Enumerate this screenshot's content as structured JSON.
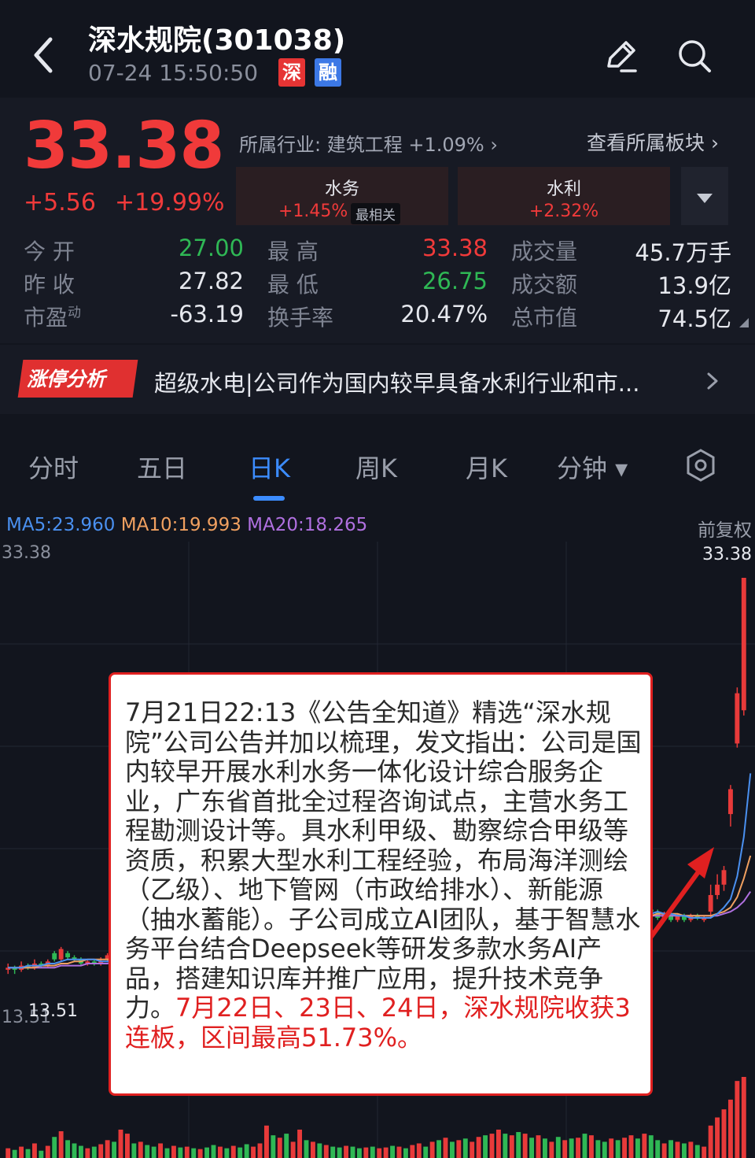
{
  "header": {
    "title": "深水规院(301038)",
    "datetime": "07-24 15:50:50",
    "tag_exchange": "深",
    "tag_margin": "融"
  },
  "quote": {
    "price": "33.38",
    "change": "+5.56",
    "change_pct": "+19.99%",
    "industry": "所属行业:  建筑工程 +1.09% ›",
    "sector_link": "查看所属板块 ›",
    "concepts": [
      {
        "name": "水务",
        "change": "+1.45%",
        "badge": "最相关"
      },
      {
        "name": "水利",
        "change": "+2.32%"
      }
    ]
  },
  "stats": {
    "open_label": "今    开",
    "open": "27.00",
    "high_label": "最    高",
    "high": "33.38",
    "volume_label": "成交量",
    "volume": "45.7万手",
    "prev_close_label": "昨    收",
    "prev_close": "27.82",
    "low_label": "最    低",
    "low": "26.75",
    "amount_label": "成交额",
    "amount": "13.9亿",
    "pe_label": "市盈",
    "pe_sup": "动",
    "pe": "-63.19",
    "turnover_label": "换手率",
    "turnover": "20.47%",
    "mktcap_label": "总市值",
    "mktcap": "74.5亿"
  },
  "limit_analysis": {
    "badge": "涨停分析",
    "text": "超级水电|公司作为国内较早具备水利行业和市..."
  },
  "tabs": [
    "分时",
    "五日",
    "日K",
    "周K",
    "月K",
    "分钟 ▾"
  ],
  "active_tab": "日K",
  "chart": {
    "ma5": "MA5:23.960",
    "ma10": "MA10:19.993",
    "ma20": "MA20:18.265",
    "adjust": "前复权",
    "top_left": "33.38",
    "top_right": "33.38",
    "bottom_left": "13.51",
    "low_marker": "13.51",
    "colors": {
      "up": "#e83a3a",
      "down": "#2fb855",
      "ma5": "#4a90f0",
      "ma10": "#f0a060",
      "ma20": "#b070e0"
    }
  },
  "chart_data": {
    "type": "candlestick",
    "ylim": [
      13.51,
      33.38
    ],
    "candles": [
      {
        "o": 14.5,
        "c": 14.6,
        "h": 14.8,
        "l": 14.3
      },
      {
        "o": 14.6,
        "c": 14.5,
        "h": 14.7,
        "l": 14.3
      },
      {
        "o": 14.5,
        "c": 14.7,
        "h": 14.9,
        "l": 14.4
      },
      {
        "o": 14.7,
        "c": 14.6,
        "h": 14.8,
        "l": 14.5
      },
      {
        "o": 14.6,
        "c": 14.8,
        "h": 15.0,
        "l": 14.5
      },
      {
        "o": 14.8,
        "c": 14.7,
        "h": 14.9,
        "l": 14.6
      },
      {
        "o": 14.7,
        "c": 14.9,
        "h": 15.0,
        "l": 14.6
      },
      {
        "o": 15.3,
        "c": 15.0,
        "h": 15.4,
        "l": 14.9
      },
      {
        "o": 15.0,
        "c": 15.5,
        "h": 15.6,
        "l": 14.9
      },
      {
        "o": 15.3,
        "c": 15.1,
        "h": 15.4,
        "l": 15.0
      },
      {
        "o": 15.1,
        "c": 15.0,
        "h": 15.2,
        "l": 14.9
      },
      {
        "o": 15.0,
        "c": 14.8,
        "h": 15.1,
        "l": 14.7
      },
      {
        "o": 14.8,
        "c": 14.9,
        "h": 15.0,
        "l": 14.7
      },
      {
        "o": 14.9,
        "c": 14.8,
        "h": 15.0,
        "l": 14.7
      },
      {
        "o": 14.8,
        "c": 14.9,
        "h": 15.1,
        "l": 14.7
      },
      {
        "o": 15.0,
        "c": 15.2,
        "h": 15.3,
        "l": 14.9
      },
      {
        "o": 15.2,
        "c": 15.1,
        "h": 15.3,
        "l": 15.0
      },
      {
        "o": 15.2,
        "c": 15.7,
        "h": 15.8,
        "l": 15.1
      },
      {
        "o": 15.7,
        "c": 15.9,
        "h": 16.0,
        "l": 15.6
      },
      {
        "o": 15.9,
        "c": 15.8,
        "h": 16.0,
        "l": 15.7
      },
      {
        "o": 15.8,
        "c": 16.0,
        "h": 16.1,
        "l": 15.7
      },
      {
        "o": 16.0,
        "c": 15.8,
        "h": 16.1,
        "l": 15.6
      },
      {
        "o": 15.8,
        "c": 15.6,
        "h": 15.9,
        "l": 15.5
      },
      {
        "o": 15.6,
        "c": 15.8,
        "h": 15.9,
        "l": 15.5
      },
      {
        "o": 15.8,
        "c": 15.7,
        "h": 15.9,
        "l": 15.6
      },
      {
        "o": 15.6,
        "c": 15.7,
        "h": 15.8,
        "l": 15.5
      },
      {
        "o": 15.7,
        "c": 15.6,
        "h": 15.8,
        "l": 15.5
      },
      {
        "o": 15.6,
        "c": 15.7,
        "h": 15.8,
        "l": 15.5
      },
      {
        "o": 15.5,
        "c": 15.4,
        "h": 15.7,
        "l": 15.3
      },
      {
        "o": 15.5,
        "c": 15.6,
        "h": 15.7,
        "l": 15.4
      },
      {
        "o": 15.6,
        "c": 15.4,
        "h": 15.7,
        "l": 15.3
      },
      {
        "o": 15.4,
        "c": 15.3,
        "h": 15.5,
        "l": 15.2
      },
      {
        "o": 15.3,
        "c": 15.4,
        "h": 15.5,
        "l": 15.2
      },
      {
        "o": 15.4,
        "c": 15.3,
        "h": 15.5,
        "l": 15.2
      },
      {
        "o": 15.3,
        "c": 15.5,
        "h": 15.6,
        "l": 15.2
      },
      {
        "o": 15.5,
        "c": 15.4,
        "h": 15.6,
        "l": 15.3
      },
      {
        "o": 15.6,
        "c": 15.4,
        "h": 15.7,
        "l": 15.3
      },
      {
        "o": 15.4,
        "c": 15.5,
        "h": 15.6,
        "l": 15.3
      },
      {
        "o": 15.5,
        "c": 15.7,
        "h": 15.8,
        "l": 15.4
      },
      {
        "o": 15.7,
        "c": 16.2,
        "h": 16.4,
        "l": 15.6
      },
      {
        "o": 16.2,
        "c": 16.1,
        "h": 16.3,
        "l": 15.9
      },
      {
        "o": 16.1,
        "c": 16.3,
        "h": 16.4,
        "l": 16.0
      },
      {
        "o": 16.3,
        "c": 16.0,
        "h": 16.4,
        "l": 15.9
      },
      {
        "o": 16.0,
        "c": 16.2,
        "h": 16.3,
        "l": 15.9
      },
      {
        "o": 16.2,
        "c": 16.5,
        "h": 16.6,
        "l": 16.1
      },
      {
        "o": 16.5,
        "c": 16.3,
        "h": 16.6,
        "l": 16.2
      },
      {
        "o": 16.3,
        "c": 16.4,
        "h": 16.5,
        "l": 16.2
      },
      {
        "o": 16.4,
        "c": 16.3,
        "h": 16.5,
        "l": 16.2
      },
      {
        "o": 16.3,
        "c": 16.4,
        "h": 16.5,
        "l": 16.2
      },
      {
        "o": 16.4,
        "c": 16.3,
        "h": 16.5,
        "l": 16.2
      },
      {
        "o": 16.3,
        "c": 16.2,
        "h": 16.4,
        "l": 16.1
      },
      {
        "o": 16.2,
        "c": 16.3,
        "h": 16.4,
        "l": 16.1
      },
      {
        "o": 16.3,
        "c": 16.2,
        "h": 16.4,
        "l": 16.1
      },
      {
        "o": 16.2,
        "c": 16.1,
        "h": 16.3,
        "l": 16.0
      },
      {
        "o": 16.1,
        "c": 16.2,
        "h": 16.3,
        "l": 16.0
      },
      {
        "o": 16.2,
        "c": 16.1,
        "h": 16.3,
        "l": 16.0
      },
      {
        "o": 16.1,
        "c": 16.2,
        "h": 16.3,
        "l": 16.0
      },
      {
        "o": 16.2,
        "c": 16.3,
        "h": 16.4,
        "l": 16.1
      },
      {
        "o": 16.3,
        "c": 16.2,
        "h": 16.4,
        "l": 16.1
      },
      {
        "o": 16.2,
        "c": 16.3,
        "h": 16.4,
        "l": 16.1
      },
      {
        "o": 16.3,
        "c": 16.2,
        "h": 16.4,
        "l": 16.1
      },
      {
        "o": 16.2,
        "c": 16.4,
        "h": 16.5,
        "l": 16.1
      },
      {
        "o": 16.4,
        "c": 16.5,
        "h": 16.6,
        "l": 16.3
      },
      {
        "o": 16.5,
        "c": 16.4,
        "h": 16.6,
        "l": 16.3
      },
      {
        "o": 16.4,
        "c": 16.6,
        "h": 16.8,
        "l": 16.3
      },
      {
        "o": 16.6,
        "c": 16.5,
        "h": 16.7,
        "l": 16.4
      },
      {
        "o": 16.5,
        "c": 16.7,
        "h": 16.8,
        "l": 16.4
      },
      {
        "o": 16.7,
        "c": 16.6,
        "h": 16.8,
        "l": 16.5
      },
      {
        "o": 16.6,
        "c": 16.8,
        "h": 16.9,
        "l": 16.5
      },
      {
        "o": 16.8,
        "c": 16.7,
        "h": 16.9,
        "l": 16.6
      },
      {
        "o": 16.7,
        "c": 16.8,
        "h": 16.9,
        "l": 16.6
      },
      {
        "o": 16.8,
        "c": 16.9,
        "h": 17.0,
        "l": 16.7
      },
      {
        "o": 16.9,
        "c": 16.8,
        "h": 17.0,
        "l": 16.7
      },
      {
        "o": 16.8,
        "c": 16.9,
        "h": 17.0,
        "l": 16.7
      },
      {
        "o": 16.9,
        "c": 17.0,
        "h": 17.1,
        "l": 16.8
      },
      {
        "o": 17.0,
        "c": 16.9,
        "h": 17.1,
        "l": 16.8
      },
      {
        "o": 16.9,
        "c": 17.1,
        "h": 17.2,
        "l": 16.8
      },
      {
        "o": 17.1,
        "c": 17.0,
        "h": 17.2,
        "l": 16.9
      },
      {
        "o": 17.0,
        "c": 17.2,
        "h": 17.3,
        "l": 16.9
      },
      {
        "o": 17.2,
        "c": 17.1,
        "h": 17.3,
        "l": 17.0
      },
      {
        "o": 17.1,
        "c": 17.2,
        "h": 17.3,
        "l": 17.0
      },
      {
        "o": 17.0,
        "c": 16.8,
        "h": 17.1,
        "l": 16.7
      },
      {
        "o": 16.8,
        "c": 17.0,
        "h": 17.1,
        "l": 16.7
      },
      {
        "o": 17.0,
        "c": 16.9,
        "h": 17.1,
        "l": 16.8
      },
      {
        "o": 16.9,
        "c": 17.1,
        "h": 17.2,
        "l": 16.8
      },
      {
        "o": 17.1,
        "c": 17.0,
        "h": 17.2,
        "l": 16.9
      },
      {
        "o": 17.0,
        "c": 17.2,
        "h": 17.3,
        "l": 16.9
      },
      {
        "o": 17.2,
        "c": 17.1,
        "h": 17.3,
        "l": 17.0
      },
      {
        "o": 17.1,
        "c": 17.3,
        "h": 17.4,
        "l": 17.0
      },
      {
        "o": 17.3,
        "c": 17.2,
        "h": 17.4,
        "l": 17.1
      },
      {
        "o": 17.2,
        "c": 17.0,
        "h": 17.3,
        "l": 16.9
      },
      {
        "o": 17.0,
        "c": 17.1,
        "h": 17.2,
        "l": 16.9
      },
      {
        "o": 17.1,
        "c": 17.0,
        "h": 17.2,
        "l": 16.9
      },
      {
        "o": 17.0,
        "c": 17.2,
        "h": 17.3,
        "l": 16.9
      },
      {
        "o": 17.2,
        "c": 17.3,
        "h": 17.4,
        "l": 17.1
      },
      {
        "o": 17.3,
        "c": 17.2,
        "h": 17.4,
        "l": 17.1
      },
      {
        "o": 17.2,
        "c": 17.4,
        "h": 17.5,
        "l": 17.1
      },
      {
        "o": 17.4,
        "c": 17.3,
        "h": 17.5,
        "l": 17.2
      },
      {
        "o": 17.3,
        "c": 17.0,
        "h": 17.4,
        "l": 16.9
      },
      {
        "o": 17.0,
        "c": 17.2,
        "h": 17.3,
        "l": 16.9
      },
      {
        "o": 17.2,
        "c": 16.9,
        "h": 17.3,
        "l": 16.8
      },
      {
        "o": 16.9,
        "c": 17.1,
        "h": 17.2,
        "l": 16.8
      },
      {
        "o": 17.1,
        "c": 16.9,
        "h": 17.2,
        "l": 16.8
      },
      {
        "o": 16.9,
        "c": 17.1,
        "h": 17.2,
        "l": 16.8
      },
      {
        "o": 17.1,
        "c": 17.0,
        "h": 17.2,
        "l": 16.9
      },
      {
        "o": 16.9,
        "c": 17.0,
        "h": 17.1,
        "l": 16.8
      },
      {
        "o": 17.3,
        "c": 18.1,
        "h": 18.6,
        "l": 17.0
      },
      {
        "o": 18.1,
        "c": 18.6,
        "h": 19.1,
        "l": 17.9
      },
      {
        "o": 18.6,
        "c": 19.3,
        "h": 19.5,
        "l": 18.3
      },
      {
        "o": 22.0,
        "c": 23.2,
        "h": 23.4,
        "l": 21.4
      },
      {
        "o": 25.4,
        "c": 27.82,
        "h": 28.1,
        "l": 25.2
      },
      {
        "o": 27.0,
        "c": 33.38,
        "h": 33.38,
        "l": 26.75
      }
    ],
    "ma5": [
      14.6,
      14.6,
      14.6,
      14.7,
      14.7,
      14.7,
      14.8,
      14.8,
      14.9,
      15.0,
      15.0,
      15.0,
      15.0,
      15.0,
      14.9,
      14.9,
      15.0,
      15.1,
      15.2,
      15.4,
      15.6,
      15.8,
      15.8,
      15.8,
      15.7,
      15.7,
      15.7,
      15.7,
      15.6,
      15.6,
      15.5,
      15.5,
      15.4,
      15.4,
      15.4,
      15.4,
      15.4,
      15.4,
      15.5,
      15.6,
      15.7,
      15.8,
      15.9,
      16.0,
      16.2,
      16.2,
      16.3,
      16.3,
      16.3,
      16.3,
      16.3,
      16.3,
      16.3,
      16.2,
      16.2,
      16.2,
      16.2,
      16.2,
      16.2,
      16.2,
      16.2,
      16.3,
      16.3,
      16.4,
      16.4,
      16.5,
      16.5,
      16.6,
      16.6,
      16.7,
      16.7,
      16.8,
      16.8,
      16.8,
      16.9,
      16.9,
      17.0,
      17.0,
      17.0,
      17.1,
      17.1,
      17.1,
      17.0,
      17.0,
      17.0,
      17.0,
      17.0,
      17.1,
      17.1,
      17.2,
      17.2,
      17.1,
      17.1,
      17.1,
      17.1,
      17.1,
      17.2,
      17.2,
      17.3,
      17.2,
      17.2,
      17.1,
      17.1,
      17.0,
      17.0,
      17.0,
      17.0,
      17.2,
      17.5,
      17.9,
      19.0,
      20.9,
      23.96
    ],
    "ma10": [
      14.6,
      14.6,
      14.6,
      14.6,
      14.6,
      14.7,
      14.7,
      14.7,
      14.8,
      14.8,
      14.9,
      14.9,
      15.0,
      15.0,
      15.0,
      15.0,
      15.0,
      15.0,
      15.1,
      15.1,
      15.2,
      15.3,
      15.4,
      15.5,
      15.6,
      15.7,
      15.7,
      15.7,
      15.7,
      15.7,
      15.6,
      15.6,
      15.6,
      15.5,
      15.5,
      15.5,
      15.5,
      15.5,
      15.5,
      15.5,
      15.6,
      15.6,
      15.7,
      15.7,
      15.8,
      15.9,
      16.0,
      16.1,
      16.1,
      16.2,
      16.2,
      16.3,
      16.3,
      16.3,
      16.3,
      16.3,
      16.3,
      16.3,
      16.3,
      16.2,
      16.2,
      16.2,
      16.3,
      16.3,
      16.3,
      16.3,
      16.4,
      16.4,
      16.5,
      16.5,
      16.6,
      16.6,
      16.7,
      16.7,
      16.8,
      16.8,
      16.8,
      16.9,
      16.9,
      16.9,
      17.0,
      17.0,
      17.0,
      17.0,
      17.0,
      17.0,
      17.0,
      17.0,
      17.1,
      17.1,
      17.1,
      17.1,
      17.1,
      17.1,
      17.1,
      17.1,
      17.1,
      17.1,
      17.2,
      17.2,
      17.2,
      17.2,
      17.1,
      17.1,
      17.1,
      17.1,
      17.1,
      17.2,
      17.3,
      17.5,
      18.0,
      18.9,
      19.993
    ],
    "ma20": [
      14.6,
      14.6,
      14.6,
      14.6,
      14.6,
      14.6,
      14.6,
      14.6,
      14.7,
      14.7,
      14.7,
      14.7,
      14.8,
      14.8,
      14.8,
      14.8,
      14.9,
      14.9,
      15.0,
      15.0,
      15.0,
      15.1,
      15.1,
      15.2,
      15.2,
      15.3,
      15.3,
      15.4,
      15.4,
      15.4,
      15.4,
      15.5,
      15.5,
      15.5,
      15.5,
      15.6,
      15.6,
      15.6,
      15.6,
      15.6,
      15.6,
      15.6,
      15.6,
      15.6,
      15.7,
      15.7,
      15.7,
      15.8,
      15.8,
      15.8,
      15.9,
      15.9,
      16.0,
      16.0,
      16.0,
      16.1,
      16.1,
      16.1,
      16.2,
      16.2,
      16.2,
      16.2,
      16.3,
      16.3,
      16.3,
      16.3,
      16.3,
      16.3,
      16.4,
      16.4,
      16.4,
      16.4,
      16.5,
      16.5,
      16.5,
      16.5,
      16.6,
      16.6,
      16.6,
      16.7,
      16.7,
      16.7,
      16.8,
      16.8,
      16.8,
      16.9,
      16.9,
      16.9,
      17.0,
      17.0,
      17.0,
      17.0,
      17.0,
      17.0,
      17.0,
      17.1,
      17.1,
      17.1,
      17.1,
      17.1,
      17.1,
      17.1,
      17.1,
      17.1,
      17.1,
      17.1,
      17.1,
      17.1,
      17.2,
      17.3,
      17.5,
      17.8,
      18.265
    ],
    "volumes": [
      12,
      10,
      14,
      11,
      18,
      9,
      15,
      26,
      33,
      22,
      18,
      15,
      12,
      14,
      17,
      22,
      20,
      35,
      30,
      18,
      20,
      16,
      14,
      18,
      12,
      15,
      13,
      14,
      12,
      11,
      13,
      16,
      14,
      12,
      15,
      13,
      17,
      14,
      18,
      40,
      28,
      25,
      30,
      20,
      35,
      22,
      20,
      18,
      16,
      14,
      13,
      15,
      14,
      12,
      13,
      14,
      12,
      13,
      15,
      14,
      12,
      16,
      18,
      14,
      20,
      22,
      25,
      20,
      22,
      24,
      20,
      26,
      28,
      30,
      35,
      30,
      28,
      32,
      30,
      25,
      28,
      24,
      20,
      26,
      22,
      24,
      25,
      30,
      28,
      22,
      20,
      24,
      22,
      25,
      28,
      24,
      30,
      28,
      22,
      18,
      22,
      20,
      18,
      20,
      16,
      14,
      40,
      50,
      60,
      72,
      95,
      100
    ],
    "volume_up": [
      true,
      false,
      true,
      false,
      true,
      false,
      true,
      false,
      true,
      false,
      false,
      false,
      true,
      false,
      true,
      true,
      false,
      true,
      true,
      false,
      true,
      false,
      false,
      true,
      false,
      true,
      false,
      true,
      false,
      true,
      false,
      false,
      true,
      false,
      true,
      false,
      false,
      true,
      true,
      true,
      false,
      true,
      false,
      true,
      true,
      false,
      true,
      false,
      true,
      false,
      false,
      true,
      false,
      false,
      true,
      false,
      true,
      true,
      false,
      true,
      false,
      true,
      true,
      false,
      true,
      false,
      true,
      false,
      true,
      false,
      true,
      true,
      false,
      true,
      true,
      false,
      true,
      false,
      true,
      false,
      true,
      false,
      true,
      false,
      true,
      false,
      true,
      false,
      true,
      false,
      false,
      true,
      false,
      true,
      true,
      false,
      true,
      false,
      false,
      true,
      false,
      true,
      false,
      true,
      false,
      true,
      true,
      true,
      true,
      true,
      true,
      true
    ]
  },
  "popup": {
    "body": "7月21日22:13《公告全知道》精选“深水规院”公司公告并加以梳理，发文指出：公司是国内较早开展水利水务一体化设计综合服务企业，广东省首批全过程咨询试点，主营水务工程勘测设计等。具水利甲级、勘察综合甲级等资质，积累大型水利工程经验，布局海洋测绘（乙级）、地下管网（市政给排水）、新能源（抽水蓄能）。子公司成立AI团队，基于智慧水务平台结合Deepseek等研发多款水务AI产品，搭建知识库并推广应用，提升技术竞争力。",
    "highlight": "7月22日、23日、24日，深水规院收获3连板，区间最高51.73%。",
    "border_color": "#e02020"
  }
}
